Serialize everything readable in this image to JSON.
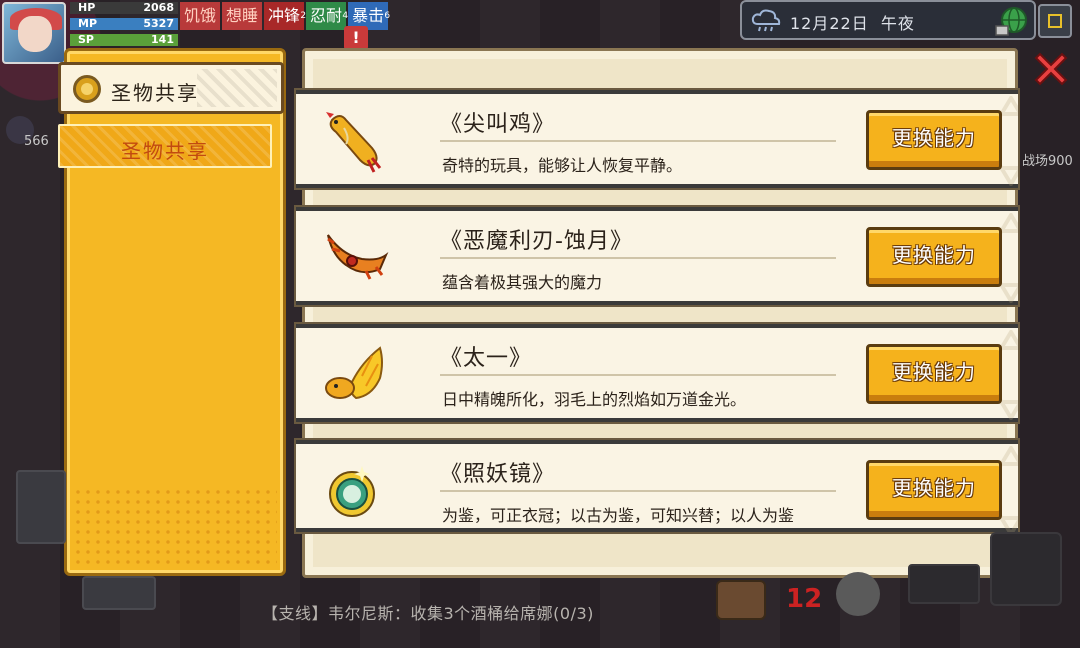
{
  "hud": {
    "hp_label": "HP",
    "hp_value": "2068",
    "mp_label": "MP",
    "mp_value": "5327",
    "sp_label": "SP",
    "sp_value": "141",
    "status_tags": [
      {
        "label": "饥饿",
        "sup": ""
      },
      {
        "label": "想睡",
        "sup": ""
      },
      {
        "label": "冲锋",
        "sup": "2"
      },
      {
        "label": "忍耐",
        "sup": "4"
      },
      {
        "label": "暴击",
        "sup": "6"
      }
    ],
    "side_count": "566"
  },
  "topbar": {
    "date": "12月22日",
    "time": "午夜"
  },
  "sidebar": {
    "header_title": "圣物共享",
    "tab_label": "圣物共享"
  },
  "items": [
    {
      "name": "《尖叫鸡》",
      "desc": "奇特的玩具，能够让人恢复平静。",
      "button": "更换能力",
      "icon": "screaming-chicken-icon"
    },
    {
      "name": "《恶魔利刃-蚀月》",
      "desc": "蕴含着极其强大的魔力",
      "button": "更换能力",
      "icon": "demon-blade-icon"
    },
    {
      "name": "《太一》",
      "desc": "日中精魄所化，羽毛上的烈焰如万道金光。",
      "button": "更换能力",
      "icon": "golden-feather-icon"
    },
    {
      "name": "《照妖镜》",
      "desc": "为鉴，可正衣冠；以古为鉴，可知兴替；以人为鉴",
      "button": "更换能力",
      "icon": "demon-mirror-icon"
    }
  ],
  "right_partial_text": "战场900",
  "quest": "【支线】韦尔尼斯：收集3个酒桶给席娜(0/3)",
  "colors": {
    "panel_bg": "#efe5c8",
    "sidebar_gold": "#f5b824",
    "button_gold": "#f5b21c",
    "tab_text": "#c24a10"
  }
}
